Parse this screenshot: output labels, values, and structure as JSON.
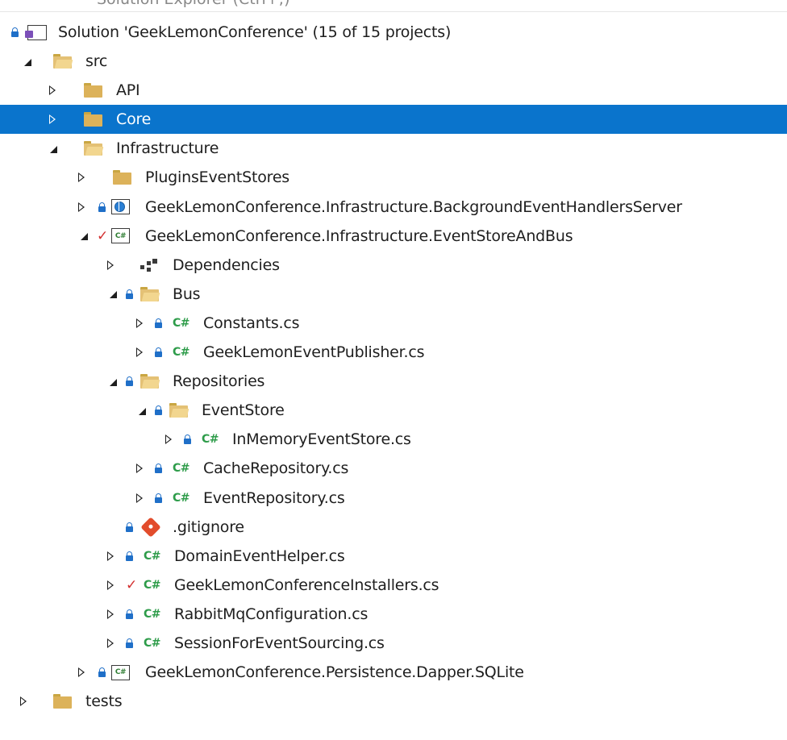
{
  "panel": "Solution Explorer",
  "top_partial": "Solution Explorer (Ctrl+;)",
  "items": [
    {
      "label": "Solution 'GeekLemonConference' (15 of 15 projects)",
      "icon": "solution-icon",
      "lock": true
    },
    {
      "label": "src",
      "icon": "folder-open-icon",
      "expanded": true
    },
    {
      "label": "API",
      "icon": "folder-icon",
      "expanded": false
    },
    {
      "label": "Core",
      "icon": "folder-icon",
      "expanded": false,
      "selected": true
    },
    {
      "label": "Infrastructure",
      "icon": "folder-open-icon",
      "expanded": true
    },
    {
      "label": "PluginsEventStores",
      "icon": "folder-icon",
      "expanded": false
    },
    {
      "label": "GeekLemonConference.Infrastructure.BackgroundEventHandlersServer",
      "icon": "web-project-icon",
      "lock": true,
      "expanded": false
    },
    {
      "label": "GeekLemonConference.Infrastructure.EventStoreAndBus",
      "icon": "csharp-project-icon",
      "check": true,
      "expanded": true
    },
    {
      "label": "Dependencies",
      "icon": "dependencies-icon",
      "expanded": false
    },
    {
      "label": "Bus",
      "icon": "folder-open-icon",
      "lock": true,
      "expanded": true
    },
    {
      "label": "Constants.cs",
      "icon": "csharp-file-icon",
      "lock": true,
      "expanded": false
    },
    {
      "label": "GeekLemonEventPublisher.cs",
      "icon": "csharp-file-icon",
      "lock": true,
      "expanded": false
    },
    {
      "label": "Repositories",
      "icon": "folder-open-icon",
      "lock": true,
      "expanded": true
    },
    {
      "label": "EventStore",
      "icon": "folder-open-icon",
      "lock": true,
      "expanded": true
    },
    {
      "label": "InMemoryEventStore.cs",
      "icon": "csharp-file-icon",
      "lock": true,
      "expanded": false
    },
    {
      "label": "CacheRepository.cs",
      "icon": "csharp-file-icon",
      "lock": true,
      "expanded": false
    },
    {
      "label": "EventRepository.cs",
      "icon": "csharp-file-icon",
      "lock": true,
      "expanded": false
    },
    {
      "label": ".gitignore",
      "icon": "git-icon",
      "lock": true
    },
    {
      "label": "DomainEventHelper.cs",
      "icon": "csharp-file-icon",
      "lock": true,
      "expanded": false
    },
    {
      "label": "GeekLemonConferenceInstallers.cs",
      "icon": "csharp-file-icon",
      "check": true,
      "expanded": false
    },
    {
      "label": "RabbitMqConfiguration.cs",
      "icon": "csharp-file-icon",
      "lock": true,
      "expanded": false
    },
    {
      "label": "SessionForEventSourcing.cs",
      "icon": "csharp-file-icon",
      "lock": true,
      "expanded": false
    },
    {
      "label": "GeekLemonConference.Persistence.Dapper.SQLite",
      "icon": "csharp-project-icon",
      "lock": true,
      "expanded": false
    },
    {
      "label": "tests",
      "icon": "folder-icon",
      "expanded": false
    }
  ],
  "colors": {
    "selection": "#0a74cc",
    "lock": "#1f6fc8",
    "check": "#d32f2f",
    "csharp": "#2e9c4a",
    "folder": "#dcb25a"
  }
}
